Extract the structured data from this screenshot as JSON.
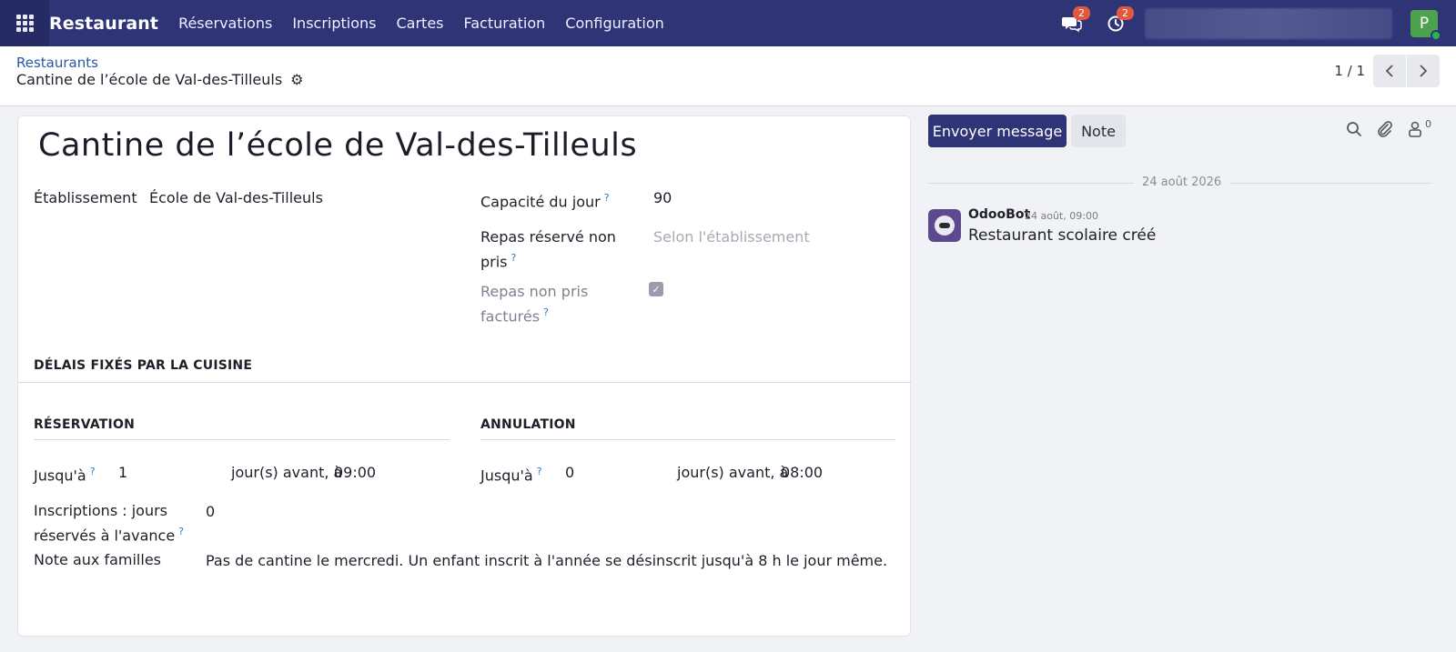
{
  "navbar": {
    "app_name": "Restaurant",
    "menu": [
      "Réservations",
      "Inscriptions",
      "Cartes",
      "Facturation",
      "Configuration"
    ],
    "messages_count": "2",
    "activities_count": "2",
    "user_initial": "P"
  },
  "breadcrumb": {
    "parent": "Restaurants",
    "current": "Cantine de l’école de Val-des-Tilleuls"
  },
  "pager": {
    "value": "1 / 1"
  },
  "form": {
    "title": "Cantine de l’école de Val-des-Tilleuls",
    "etablissement_label": "Établissement",
    "etablissement_value": "École de Val-des-Tilleuls",
    "capacite_label": "Capacité du jour",
    "capacite_value": "90",
    "repas_reserve_label_1": "Repas réservé non",
    "repas_reserve_label_2": "pris",
    "repas_reserve_placeholder": "Selon l'établissement",
    "repas_factures_label_1": "Repas non pris",
    "repas_factures_label_2": "facturés",
    "repas_factures_checked": true,
    "delais_section": "DÉLAIS FIXÉS PAR LA CUISINE",
    "reservation_section": "RÉSERVATION",
    "annulation_section": "ANNULATION",
    "reservation": {
      "label": "Jusqu'à",
      "days": "1",
      "suffix": "jour(s) avant, à",
      "time": "09:00"
    },
    "annulation": {
      "label": "Jusqu'à",
      "days": "0",
      "suffix": "jour(s) avant, à",
      "time": "08:00"
    },
    "inscriptions_label_1": "Inscriptions : jours",
    "inscriptions_label_2": "réservés à l'avance",
    "inscriptions_value": "0",
    "note_label": "Note aux familles",
    "note_value": "Pas de cantine le mercredi. Un enfant inscrit à l'année se désinscrit jusqu'à 8 h le jour même."
  },
  "chatter": {
    "send_message": "Envoyer message",
    "note": "Note",
    "followers_count": "0",
    "date_separator": "24 août 2026",
    "message": {
      "author": "OdooBot",
      "date": "24 août, 09:00",
      "body": "Restaurant scolaire créé"
    }
  }
}
